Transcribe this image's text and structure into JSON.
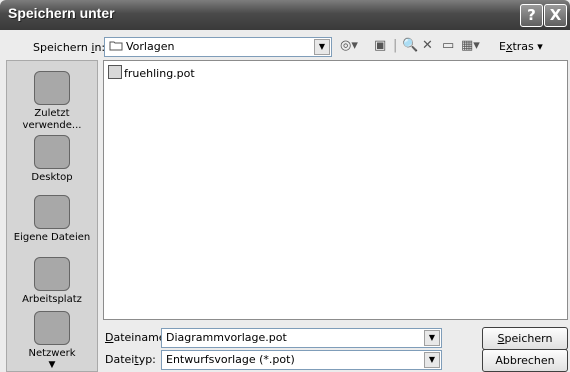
{
  "window": {
    "title": "Speichern unter",
    "help_button": "?",
    "close_button": "X"
  },
  "lookin": {
    "label_pre": "Speichern ",
    "label_ul": "i",
    "label_post": "n:",
    "value": "Vorlagen"
  },
  "toolbar": {
    "extras_pre": "E",
    "extras_ul": "x",
    "extras_post": "tras"
  },
  "places": [
    {
      "label": "Zuletzt verwende..."
    },
    {
      "label": "Desktop"
    },
    {
      "label": "Eigene Dateien"
    },
    {
      "label": "Arbeitsplatz"
    },
    {
      "label": "Netzwerk"
    }
  ],
  "files": [
    {
      "name": "fruehling.pot"
    }
  ],
  "filename": {
    "label_ul": "D",
    "label_rest": "ateiname:",
    "value": "Diagrammvorlage.pot"
  },
  "filetype": {
    "label_pre": "Datei",
    "label_ul": "t",
    "label_post": "yp:",
    "value": "Entwurfsvorlage (*.pot)"
  },
  "buttons": {
    "save_ul": "S",
    "save_rest": "peichern",
    "cancel": "Abbrechen"
  }
}
